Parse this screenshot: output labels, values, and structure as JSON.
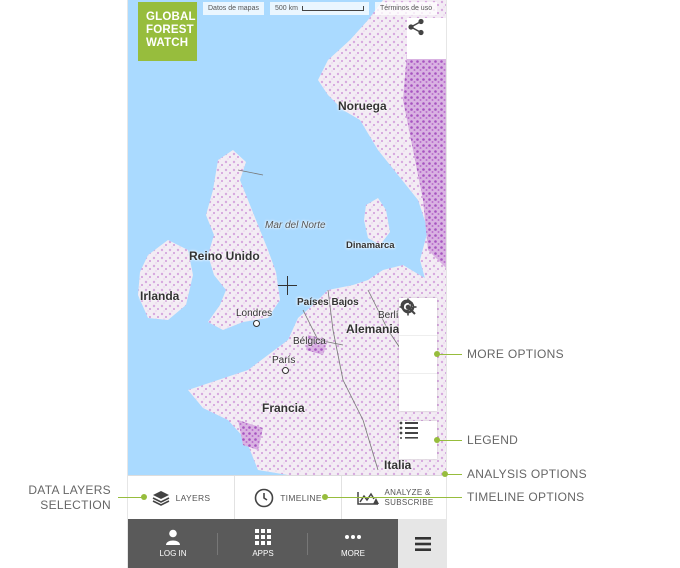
{
  "logo": {
    "line1": "GLOBAL",
    "line2": "FOREST",
    "line3": "WATCH"
  },
  "attribution": {
    "map_data": "Datos de mapas",
    "scale": "500 km",
    "terms": "Términos de uso"
  },
  "map_labels": {
    "norway": "Noruega",
    "north_sea": "Mar del Norte",
    "denmark": "Dinamarca",
    "uk": "Reino Unido",
    "ireland": "Irlanda",
    "netherlands": "Países Bajos",
    "london": "Londres",
    "berlin": "Berlí",
    "germany": "Alemania",
    "belgium": "Bélgica",
    "paris": "París",
    "france": "Francia",
    "italy": "Italia"
  },
  "icons": {
    "share": "share-icon",
    "refresh": "refresh-icon",
    "search": "search-icon",
    "locate": "locate-icon",
    "legend": "legend-list-icon",
    "layers": "layers-icon",
    "timeline": "clock-icon",
    "analyze": "chart-icon",
    "user": "user-icon",
    "apps": "grid-icon",
    "more": "dots-icon",
    "menu": "hamburger-icon"
  },
  "tabs": {
    "layers": "LAYERS",
    "timeline": "TIMELINE",
    "analyze_line1": "ANALYZE &",
    "analyze_line2": "SUBSCRIBE"
  },
  "nav": {
    "login": "LOG IN",
    "apps": "APPS",
    "more": "MORE"
  },
  "callouts": {
    "more_options": "MORE OPTIONS",
    "legend": "LEGEND",
    "analysis_options": "ANALYSIS OPTIONS",
    "timeline_options": "TIMELINE OPTIONS",
    "data_layers_line1": "DATA LAYERS",
    "data_layers_line2": "SELECTION"
  },
  "colors": {
    "brand_green": "#97bd3d",
    "water": "#aadaff",
    "nav_bg": "#5a5a5a",
    "forest_loss": "#c98bd6"
  }
}
